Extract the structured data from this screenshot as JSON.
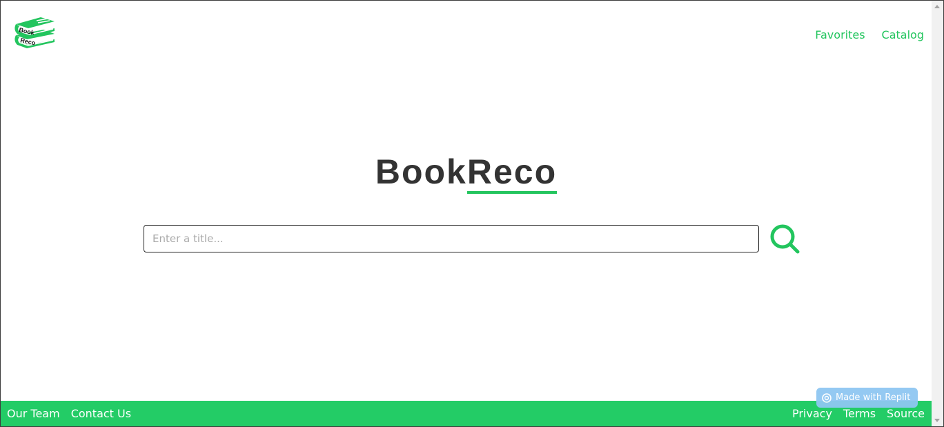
{
  "header": {
    "logo_line1": "Book",
    "logo_line2": "Reco",
    "nav": [
      {
        "label": "Favorites"
      },
      {
        "label": "Catalog"
      }
    ]
  },
  "main": {
    "title_part1": "Book",
    "title_part2": "Reco",
    "search": {
      "placeholder": "Enter a title...",
      "value": ""
    },
    "search_icon": "magnifier-icon"
  },
  "footer": {
    "left_links": [
      {
        "label": "Our Team"
      },
      {
        "label": "Contact Us"
      }
    ],
    "right_links": [
      {
        "label": "Privacy"
      },
      {
        "label": "Terms"
      },
      {
        "label": "Source"
      }
    ]
  },
  "badge": {
    "label": "Made with Replit",
    "icon": "replit-icon"
  },
  "colors": {
    "accent": "#23c55e",
    "footer_bg": "#23cc66",
    "title": "#333333",
    "badge_bg": "#8fc7f2"
  }
}
